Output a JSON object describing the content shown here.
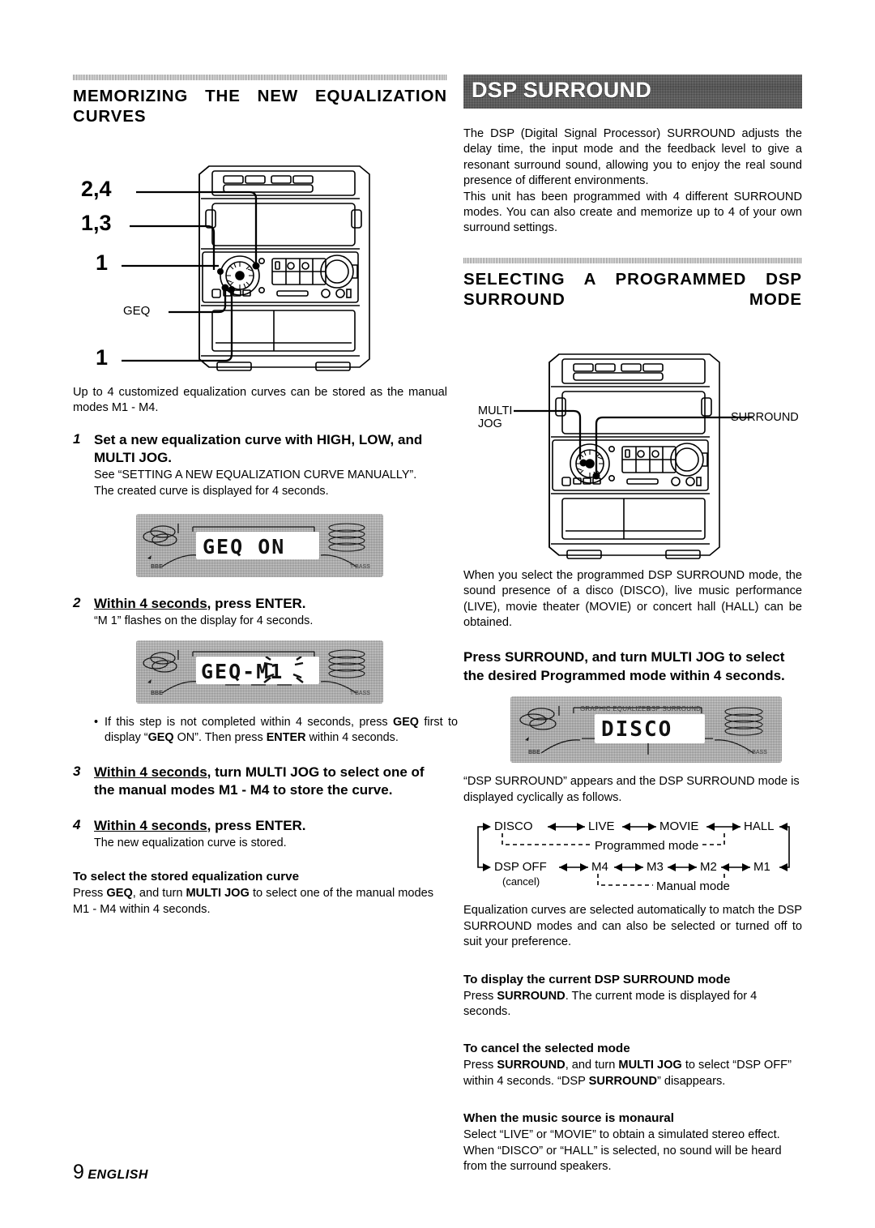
{
  "page": {
    "number": "9",
    "language": "ENGLISH"
  },
  "left_column": {
    "heading": "MEMORIZING THE NEW EQUALIZATION CURVES",
    "diagram": {
      "name": "stereo-system-front-panel",
      "callouts": [
        {
          "label": "2,4",
          "style": "big"
        },
        {
          "label": "1,3",
          "style": "big"
        },
        {
          "label": "1",
          "style": "big"
        },
        {
          "label": "GEQ",
          "style": "small"
        },
        {
          "label": "1",
          "style": "big"
        }
      ]
    },
    "intro": "Up to 4 customized equalization curves can be stored as the manual modes M1 -  M4.",
    "steps": [
      {
        "number": "1",
        "heading": "Set a new equalization curve with HIGH, LOW, and MULTI JOG.",
        "sub_line1": "See “SETTING A NEW EQUALIZATION CURVE MANUALLY”.",
        "sub_line2": "The created curve is displayed for 4 seconds."
      },
      {
        "number": "2",
        "heading_underlined": "Within 4 seconds",
        "heading_rest": ",  press ENTER.",
        "sub_line1": "“M 1” flashes on the display for 4 seconds."
      },
      {
        "number": "3",
        "heading_underlined": "Within 4 seconds",
        "heading_rest": ", turn MULTI JOG to select one of the manual modes M1 -  M4 to store the curve."
      },
      {
        "number": "4",
        "heading_underlined": "Within 4 seconds",
        "heading_rest": ", press ENTER.",
        "sub_line1": "The new  equalization curve is stored."
      }
    ],
    "display_1": {
      "name": "lcd-display-geq-on",
      "text": "GEQ ON"
    },
    "display_2": {
      "name": "lcd-display-geq-m1",
      "text": "GEQ-M1"
    },
    "bullet_note": "If this step is not completed within 4 seconds, press GEQ first to display “GEQ ON”. Then press ENTER within 4 seconds.",
    "select_stored": {
      "heading": "To select the stored  equalization curve",
      "body": "Press GEQ,  and turn MULTI JOG to select one of the manual modes M1 -  M4 within 4 seconds."
    }
  },
  "right_column": {
    "banner_title": "DSP SURROUND",
    "intro_p1": "The DSP (Digital Signal Processor) SURROUND adjusts the delay time, the input mode and the feedback level to give a resonant surround sound, allowing you to enjoy the real sound presence of different environments.",
    "intro_p2": "This unit has been programmed with 4 different SURROUND modes.  You can also create and memorize up to 4 of your own surround settings.",
    "heading": "SELECTING A PROGRAMMED DSP SURROUND MODE",
    "diagram": {
      "name": "stereo-system-front-panel",
      "callouts": [
        {
          "label": "MULTI\nJOG"
        },
        {
          "label": "SURROUND"
        }
      ]
    },
    "body_p1": "When you select the programmed DSP SURROUND mode, the sound presence of a disco (DISCO), live music performance (LIVE), movie theater (MOVIE) or concert hall (HALL) can be obtained.",
    "cta": "Press SURROUND, and turn MULTI JOG to select the desired Programmed mode within 4 seconds.",
    "display_3": {
      "name": "lcd-display-disco",
      "text": "DISCO",
      "indicator_left": "GRAPHIC EQUALIZER",
      "indicator_right": "DSP SURROUND"
    },
    "cycle_intro": "“DSP SURROUND” appears and the DSP SURROUND mode is displayed cyclically as follows.",
    "cycle_diagram": {
      "programmed_modes": [
        "DISCO",
        "LIVE",
        "MOVIE",
        "HALL"
      ],
      "programmed_label": "Programmed mode",
      "manual_modes": [
        "DSP OFF",
        "M4",
        "M3",
        "M2",
        "M1"
      ],
      "manual_label": "Manual mode",
      "cancel_note": "(cancel)"
    },
    "body_p2": "Equalization curves are selected automatically to match the DSP SURROUND modes and can also be selected or turned off to suit your preference.",
    "sections": [
      {
        "heading": "To display the current DSP SURROUND mode",
        "body": "Press SURROUND. The current mode is displayed for 4 seconds."
      },
      {
        "heading": "To cancel the selected mode",
        "body": "Press SURROUND, and turn MULTI JOG to select “DSP OFF” within 4 seconds. “DSP SURROUND” disappears."
      },
      {
        "heading": "When the music source is monaural",
        "body": "Select “LIVE” or “MOVIE” to obtain a simulated stereo effect. When “DISCO” or “HALL” is selected, no sound will be heard from the surround speakers."
      }
    ]
  }
}
